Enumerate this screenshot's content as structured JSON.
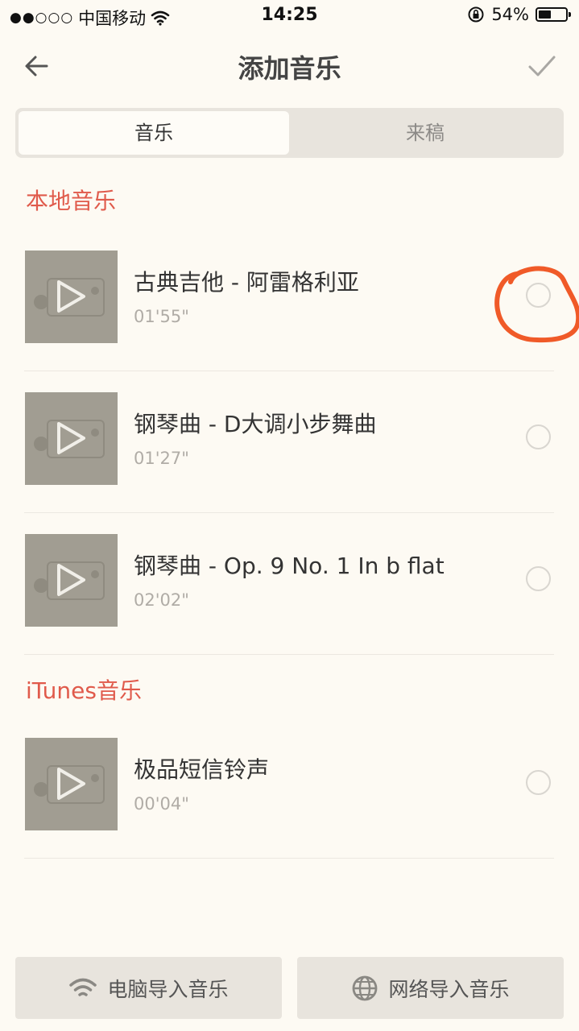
{
  "status_bar": {
    "signal": "●●○○○",
    "carrier": "中国移动",
    "time": "14:25",
    "battery_text": "54%",
    "battery_level": 0.54
  },
  "nav": {
    "title": "添加音乐",
    "back_icon": "arrow-left-icon",
    "done_icon": "checkmark-icon"
  },
  "tabs": [
    {
      "label": "音乐",
      "active": true
    },
    {
      "label": "来稿",
      "active": false
    }
  ],
  "sections": [
    {
      "title": "本地音乐",
      "tracks": [
        {
          "title": "古典吉他 - 阿雷格利亚",
          "duration": "01'55\"",
          "selected": false
        },
        {
          "title": "钢琴曲 - D大调小步舞曲",
          "duration": "01'27\"",
          "selected": false
        },
        {
          "title": "钢琴曲 - Op. 9 No. 1 In b flat",
          "duration": "02'02\"",
          "selected": false
        }
      ]
    },
    {
      "title": "iTunes音乐",
      "tracks": [
        {
          "title": "极品短信铃声",
          "duration": "00'04\"",
          "selected": false
        }
      ]
    }
  ],
  "bottom": {
    "computer_import": "电脑导入音乐",
    "web_import": "网络导入音乐"
  },
  "colors": {
    "accent": "#e05a4b",
    "background": "#fdfaf3",
    "annotation": "#f05a28"
  }
}
